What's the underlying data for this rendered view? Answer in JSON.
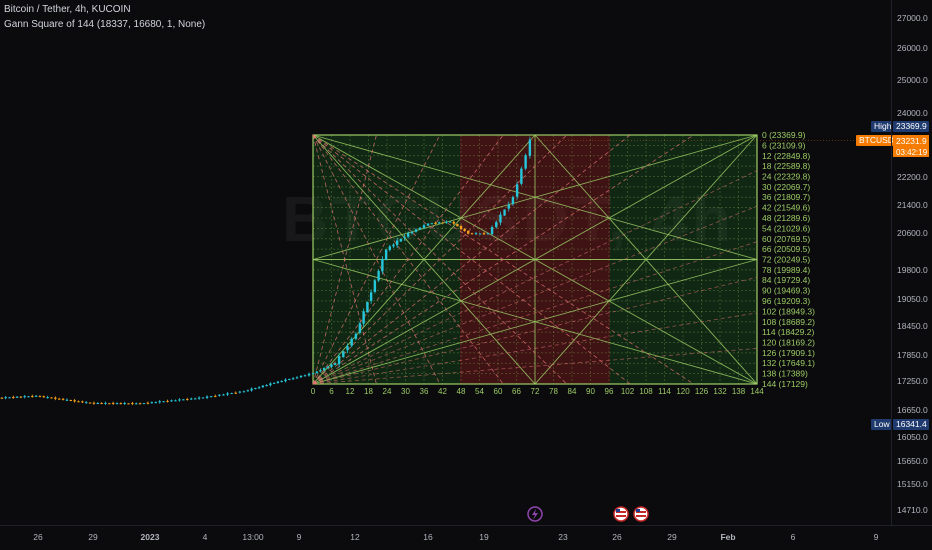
{
  "header": {
    "symbol_line": "Bitcoin / Tether, 4h, KUCOIN",
    "indicator_line": "Gann Square of 144 (18337, 16680, 1, None)"
  },
  "watermark": {
    "big": "BTCUSDT, 4h",
    "small": "Bitcoin / Tether"
  },
  "price_axis": {
    "ticks": [
      "27000.0",
      "26000.0",
      "25000.0",
      "24000.0",
      "23000.0",
      "22200.0",
      "21400.0",
      "20600.0",
      "19800.0",
      "19050.0",
      "18450.0",
      "17850.0",
      "17250.0",
      "16650.0",
      "16050.0",
      "15650.0",
      "15150.0",
      "14710.0"
    ]
  },
  "time_axis": {
    "ticks": [
      "26",
      "29",
      "2023",
      "4",
      "13:00",
      "9",
      "12",
      "16",
      "19",
      "23",
      "26",
      "29",
      "Feb",
      "6",
      "9"
    ]
  },
  "badges": {
    "high_label": "High",
    "high_value": "23369.9",
    "symbol_label": "BTCUSDT",
    "last_price": "23231.9",
    "countdown": "03:42:19",
    "low_label": "Low",
    "low_value": "16341.4"
  },
  "colors": {
    "bg": "#0b0b0d",
    "up": "#26c6da",
    "down": "#f7a21b",
    "grid_line": "#9ccc65",
    "gann_label": "#9ccc65",
    "zone_green": "#1b5e20",
    "zone_red": "#7f1d1d",
    "dashed": "#e57373",
    "badge_blue": "#1e3a6e",
    "badge_orange": "#f57c00"
  },
  "chart_data": {
    "type": "line",
    "title": "Bitcoin / Tether, 4h, KUCOIN",
    "instrument": "BTCUSDT",
    "timeframe": "4h",
    "price_series": {
      "name": "BTCUSDT",
      "x": [
        "Dec 24",
        "Dec 26",
        "Dec 29",
        "Jan 1",
        "Jan 4",
        "Jan 7",
        "Jan 9",
        "Jan 10",
        "Jan 11",
        "Jan 12",
        "Jan 13",
        "Jan 14",
        "Jan 15",
        "Jan 16",
        "Jan 17",
        "Jan 18",
        "Jan 19",
        "Jan 20",
        "Jan 21"
      ],
      "close": [
        16780,
        16830,
        16650,
        16640,
        16790,
        16950,
        17160,
        17280,
        17400,
        17650,
        18400,
        20500,
        20900,
        21150,
        21200,
        20900,
        20900,
        21800,
        23232
      ]
    },
    "gann": {
      "high": 23369.9,
      "low": 17129,
      "levels": [
        {
          "step": 0,
          "price": 23369.9
        },
        {
          "step": 6,
          "price": 23109.9
        },
        {
          "step": 12,
          "price": 22849.8
        },
        {
          "step": 18,
          "price": 22589.8
        },
        {
          "step": 24,
          "price": 22329.8
        },
        {
          "step": 30,
          "price": 22069.7
        },
        {
          "step": 36,
          "price": 21809.7
        },
        {
          "step": 42,
          "price": 21549.6
        },
        {
          "step": 48,
          "price": 21289.6
        },
        {
          "step": 54,
          "price": 21029.6
        },
        {
          "step": 60,
          "price": 20769.5
        },
        {
          "step": 66,
          "price": 20509.5
        },
        {
          "step": 72,
          "price": 20249.5
        },
        {
          "step": 78,
          "price": 19989.4
        },
        {
          "step": 84,
          "price": 19729.4
        },
        {
          "step": 90,
          "price": 19469.3
        },
        {
          "step": 96,
          "price": 19209.3
        },
        {
          "step": 102,
          "price": 18949.3
        },
        {
          "step": 108,
          "price": 18689.2
        },
        {
          "step": 114,
          "price": 18429.2
        },
        {
          "step": 120,
          "price": 18169.2
        },
        {
          "step": 126,
          "price": 17909.1
        },
        {
          "step": 132,
          "price": 17649.1
        },
        {
          "step": 138,
          "price": 17389
        },
        {
          "step": 144,
          "price": 17129
        }
      ],
      "bottom_steps": [
        "0",
        "6",
        "12",
        "18",
        "24",
        "30",
        "36",
        "42",
        "48",
        "54",
        "60",
        "66",
        "72",
        "78",
        "84",
        "90",
        "96",
        "102",
        "108",
        "114",
        "120",
        "126",
        "132",
        "138",
        "144"
      ]
    },
    "ylim": [
      14710,
      27000
    ],
    "grid": false,
    "xlabel": "",
    "ylabel": ""
  }
}
